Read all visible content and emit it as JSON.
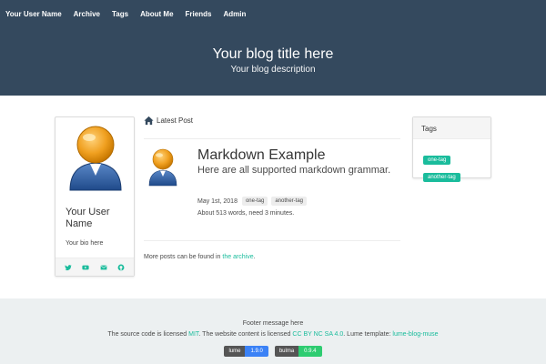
{
  "nav": {
    "items": [
      "Your User Name",
      "Archive",
      "Tags",
      "About Me",
      "Friends",
      "Admin"
    ]
  },
  "hero": {
    "title": "Your blog title here",
    "description": "Your blog description"
  },
  "profile": {
    "name": "Your User Name",
    "bio": "Your bio here",
    "social_icons": [
      "twitter-icon",
      "youtube-icon",
      "mail-icon",
      "github-icon"
    ]
  },
  "main": {
    "section_label": "Latest Post",
    "post": {
      "title": "Markdown Example",
      "subtitle": "Here are all supported markdown grammar.",
      "date": "May 1st, 2018",
      "tags": [
        "one-tag",
        "another-tag"
      ],
      "stats": "About 513 words, need 3 minutes."
    },
    "more_text": "More posts can be found in ",
    "more_link": "the archive",
    "more_suffix": "."
  },
  "tags_panel": {
    "title": "Tags",
    "tags": [
      "one-tag",
      "another-tag"
    ]
  },
  "footer": {
    "message": "Footer message here",
    "lic_1": "The source code is licensed ",
    "lic_link_1": "MIT",
    "lic_2": ". The website content is licensed ",
    "lic_link_2": "CC BY NC SA 4.0",
    "lic_3": ". Lume template: ",
    "lic_link_3": "lume-blog-muse",
    "badges": [
      {
        "name": "lume",
        "version": "1.9.0",
        "color": "#3b82f6"
      },
      {
        "name": "bulma",
        "version": "0.9.4",
        "color": "#2ecc71"
      }
    ]
  },
  "colors": {
    "hero_bg": "#34495e",
    "accent": "#1abc9c",
    "footer_bg": "#ecf0f1"
  }
}
